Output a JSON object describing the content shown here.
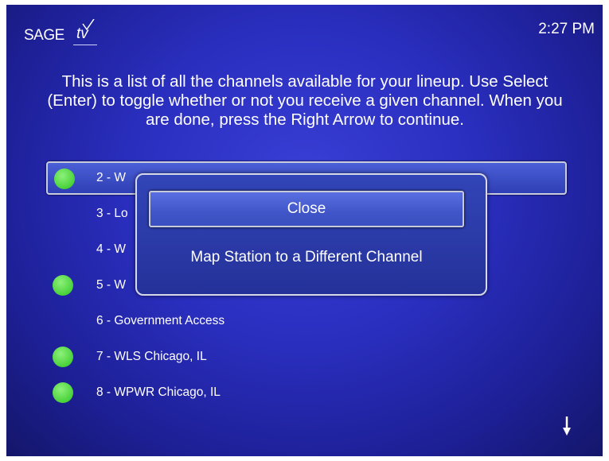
{
  "brand": {
    "sage_text": "SAGE",
    "tv_text": "tv"
  },
  "header": {
    "time": "2:27 PM"
  },
  "instructions": "This is a list of all the channels available for your lineup. Use Select (Enter) to toggle whether or not you receive a given channel. When you are done, press the Right Arrow to continue.",
  "channels": [
    {
      "label": "2 - W",
      "received": true,
      "selected": true
    },
    {
      "label": "3 - Lo",
      "received": false,
      "selected": false
    },
    {
      "label": "4 - W",
      "received": false,
      "selected": false
    },
    {
      "label": "5 - W",
      "received": true,
      "selected": false
    },
    {
      "label": "6 - Government Access",
      "received": false,
      "selected": false
    },
    {
      "label": "7 - WLS Chicago, IL",
      "received": true,
      "selected": false
    },
    {
      "label": "8 - WPWR Chicago, IL",
      "received": true,
      "selected": false
    }
  ],
  "popup": {
    "close_label": "Close",
    "map_label": "Map Station to a Different Channel"
  },
  "icons": {
    "received_indicator": "green-dot-icon",
    "scroll": "down-arrow-icon",
    "logo": "sagetv-logo"
  },
  "colors": {
    "background": "#2a2fc0",
    "received_indicator": "#49d23a",
    "text": "#ffffff"
  }
}
